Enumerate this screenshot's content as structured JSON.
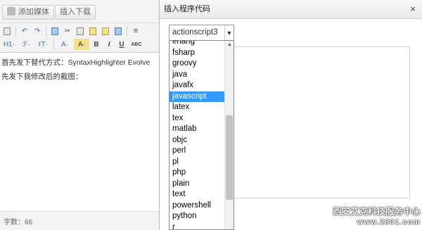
{
  "topbar": {
    "add_media": "添加媒体",
    "insert_download": "插入下载"
  },
  "toolbar": {
    "heading": "H1·",
    "font_family": "ℱ·",
    "font_size": "ᴛT·",
    "text_color": "A·",
    "bg_color": "A·",
    "bold": "B",
    "italic": "I",
    "underline": "U",
    "strike": "ABC"
  },
  "content": {
    "line1": "首先发下替代方式：SyntaxHighlighter Evolve",
    "line2": "先发下我修改后的截图："
  },
  "status": {
    "word_count": "字数：66"
  },
  "dialog": {
    "title": "插入程序代码",
    "close": "×",
    "selected_language": "actionscript3",
    "options": [
      "erlang",
      "fsharp",
      "groovy",
      "java",
      "javafx",
      "javascript",
      "latex",
      "tex",
      "matlab",
      "objc",
      "perl",
      "pl",
      "php",
      "plain",
      "text",
      "powershell",
      "python",
      "r"
    ],
    "highlighted_option": "javascript"
  },
  "watermark": {
    "line1": "西安艾克科技服务中心",
    "line2": "www.2801.com"
  }
}
